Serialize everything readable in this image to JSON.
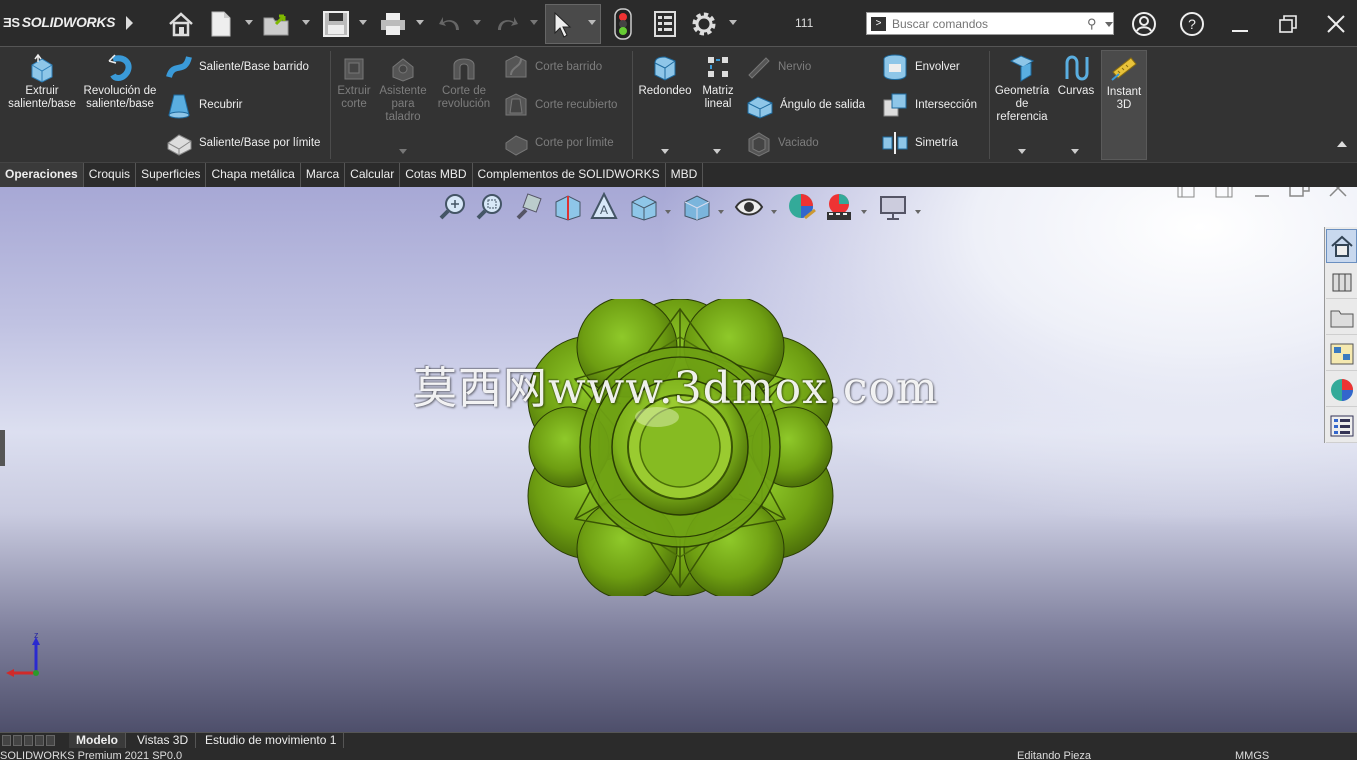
{
  "app": {
    "logo": "SOLIDWORKS",
    "rebuild_count": "111",
    "search_placeholder": "Buscar comandos"
  },
  "ribbon": {
    "extrude_boss": "Extruir saliente/base",
    "revolve_boss": "Revolución de saliente/base",
    "swept_boss": "Saliente/Base barrido",
    "lofted_boss": "Recubrir",
    "boundary_boss": "Saliente/Base por límite",
    "extruded_cut": "Extruir corte",
    "hole_wizard": "Asistente para taladro",
    "revolved_cut": "Corte de revolución",
    "swept_cut": "Corte barrido",
    "lofted_cut": "Corte recubierto",
    "boundary_cut": "Corte por límite",
    "fillet": "Redondeo",
    "linear_pattern": "Matriz lineal",
    "rib": "Nervio",
    "draft": "Ángulo de salida",
    "shell": "Vaciado",
    "wrap": "Envolver",
    "intersect": "Intersección",
    "mirror": "Simetría",
    "reference_geometry": "Geometría de referencia",
    "curves": "Curvas",
    "instant3d": "Instant 3D"
  },
  "tabs": [
    "Operaciones",
    "Croquis",
    "Superficies",
    "Chapa metálica",
    "Marca",
    "Calcular",
    "Cotas MBD",
    "Complementos de SOLIDWORKS",
    "MBD"
  ],
  "watermark": "莫西网www.3dmox.com",
  "triad": {
    "z_label": "z"
  },
  "bottom_tabs": [
    "Modelo",
    "Vistas 3D",
    "Estudio de movimiento 1"
  ],
  "status": {
    "version": "SOLIDWORKS Premium 2021 SP0.0",
    "mode": "Editando Pieza",
    "units": "MMGS"
  },
  "colors": {
    "accent": "#7fb800",
    "part_green": "#6e9e12",
    "toolbar_bg": "#333333"
  }
}
